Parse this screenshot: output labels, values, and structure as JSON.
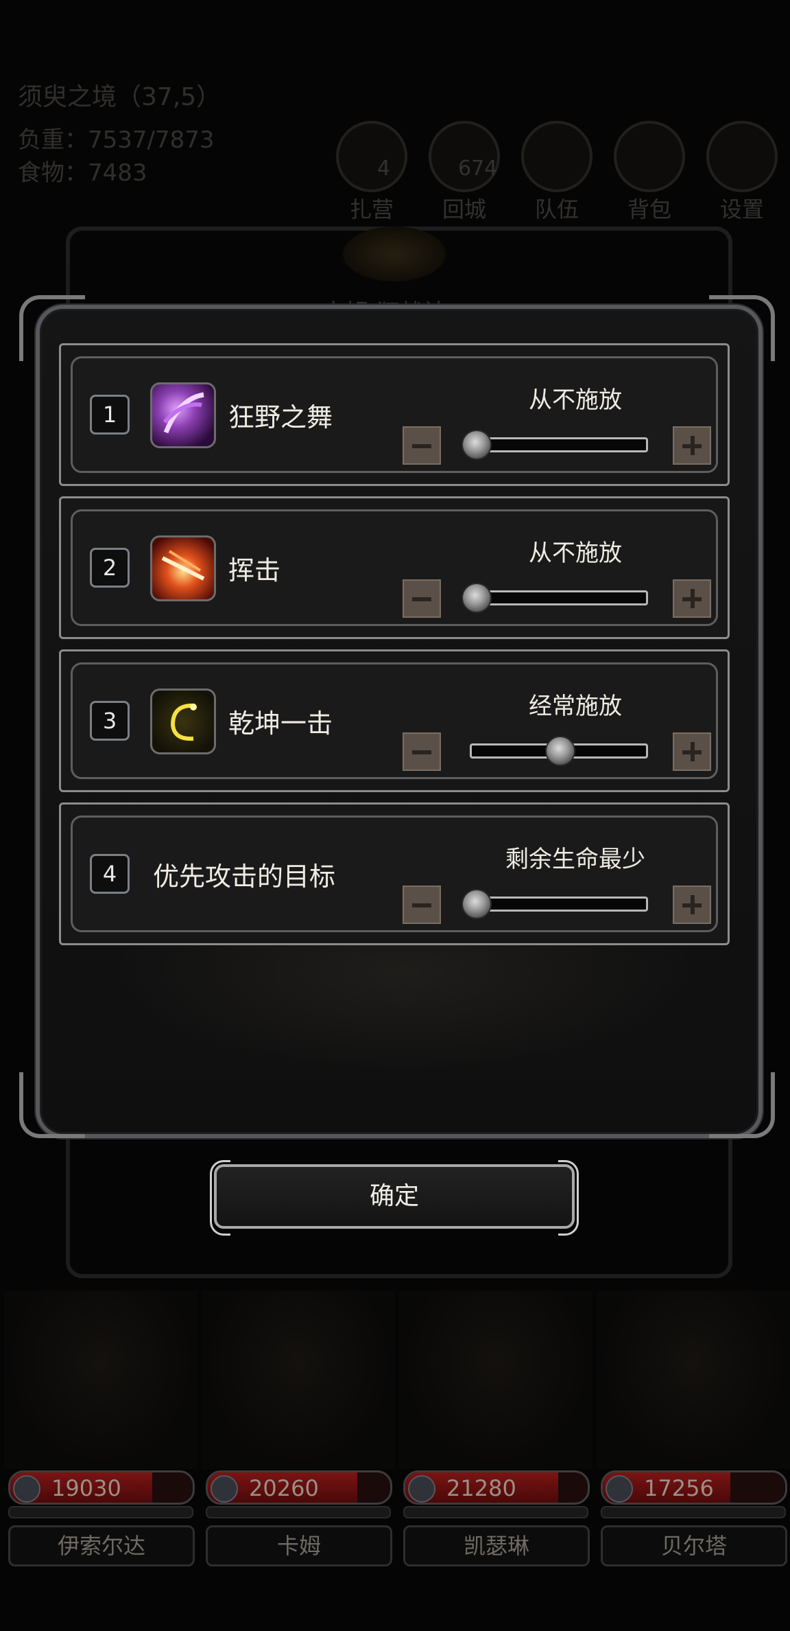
{
  "background": {
    "location": "须臾之境（37,5）",
    "load": "负重：7537/7873",
    "food": "食物：7483",
    "top_buttons": [
      {
        "label": "扎营",
        "icon": "camp-icon"
      },
      {
        "label": "回城",
        "icon": "return-icon"
      },
      {
        "label": "队伍",
        "icon": "team-icon"
      },
      {
        "label": "背包",
        "icon": "bag-icon"
      },
      {
        "label": "设置",
        "icon": "settings-icon"
      }
    ],
    "camp_count": "4",
    "return_count": "674",
    "panel_title": "卡姆 狂战神"
  },
  "skills": [
    {
      "number": "1",
      "name": "狂野之舞",
      "status": "从不施放",
      "level": 0.0,
      "icon": "wild-dance-icon",
      "color": "#8a3fb0"
    },
    {
      "number": "2",
      "name": "挥击",
      "status": "从不施放",
      "level": 0.0,
      "icon": "swing-strike-icon",
      "color": "#c0301c"
    },
    {
      "number": "3",
      "name": "乾坤一击",
      "status": "经常施放",
      "level": 0.5,
      "icon": "cosmic-strike-icon",
      "color": "#d8c030"
    }
  ],
  "target": {
    "number": "4",
    "name": "优先攻击的目标",
    "status": "剩余生命最少",
    "level": 0.0
  },
  "confirm_label": "确定",
  "heroes": [
    {
      "name": "伊索尔达",
      "hp": "19030",
      "hp_fill": 0.78
    },
    {
      "name": "卡姆",
      "hp": "20260",
      "hp_fill": 0.82
    },
    {
      "name": "凯瑟琳",
      "hp": "21280",
      "hp_fill": 0.84
    },
    {
      "name": "贝尔塔",
      "hp": "17256",
      "hp_fill": 0.7
    }
  ]
}
